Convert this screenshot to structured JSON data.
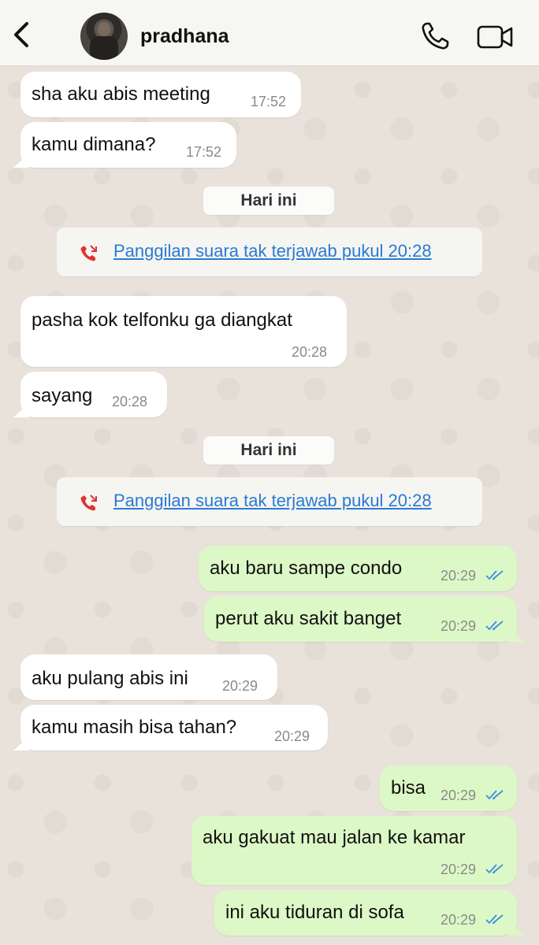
{
  "header": {
    "contact_name": "pradhana",
    "back_icon": "chevron-left-icon",
    "call_icon": "phone-icon",
    "video_icon": "video-camera-icon"
  },
  "colors": {
    "incoming_bubble": "#ffffff",
    "outgoing_bubble": "#dcf8c6",
    "missed_call": "#e2322e",
    "link_blue": "#2a7ad3",
    "read_ticks": "#3b8ee6"
  },
  "messages": [
    {
      "text": "sha aku abis meeting",
      "time": "17:52"
    },
    {
      "text": "kamu dimana?",
      "time": "17:52"
    },
    {
      "date": "Hari ini"
    },
    {
      "call": "Panggilan suara tak terjawab pukul 20:28"
    },
    {
      "text": "pasha kok telfonku ga diangkat",
      "time": "20:28"
    },
    {
      "text": "sayang",
      "time": "20:28"
    },
    {
      "date": "Hari ini"
    },
    {
      "call": "Panggilan suara tak terjawab pukul 20:28"
    },
    {
      "text": "aku baru sampe condo",
      "time": "20:29"
    },
    {
      "text": "perut aku sakit banget",
      "time": "20:29"
    },
    {
      "text": "aku pulang abis ini",
      "time": "20:29"
    },
    {
      "text": "kamu masih bisa tahan?",
      "time": "20:29"
    },
    {
      "text": "bisa",
      "time": "20:29"
    },
    {
      "text": "aku gakuat mau jalan ke kamar",
      "time": "20:29"
    },
    {
      "text": "ini aku tiduran di sofa",
      "time": "20:29"
    }
  ]
}
